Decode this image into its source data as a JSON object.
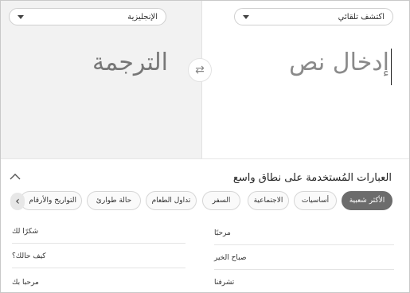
{
  "source_lang": {
    "label": "اكتشف تلقائي"
  },
  "target_lang": {
    "label": "الإنجليزية"
  },
  "input_text": "إدخال نص",
  "output_text": "الترجمة",
  "swap_icon": "⇄",
  "phrases": {
    "title": "العبارات المُستخدمة على نطاق واسع",
    "categories": [
      "الأكثر شعبية",
      "أساسيات",
      "الاجتماعية",
      "السفر",
      "تداول الطعام",
      "حالة طوارئ",
      "التواريخ والأرقام"
    ],
    "right_column": [
      "مرحبًا",
      "صباح الخير",
      "تشرفنا"
    ],
    "left_column": [
      "شكرًا لك",
      "كيف حالك؟",
      "مرحبا بك"
    ]
  }
}
